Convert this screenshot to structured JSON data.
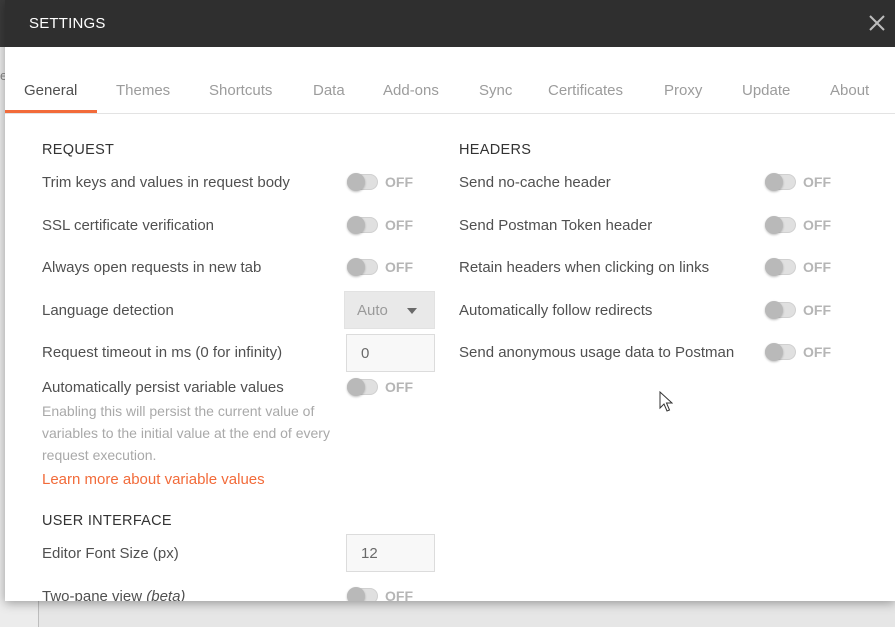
{
  "modal": {
    "title": "SETTINGS"
  },
  "tabs": [
    {
      "label": "General",
      "active": true
    },
    {
      "label": "Themes"
    },
    {
      "label": "Shortcuts"
    },
    {
      "label": "Data"
    },
    {
      "label": "Add-ons"
    },
    {
      "label": "Sync"
    },
    {
      "label": "Certificates"
    },
    {
      "label": "Proxy"
    },
    {
      "label": "Update"
    },
    {
      "label": "About"
    }
  ],
  "request": {
    "title": "REQUEST",
    "trim_keys": "Trim keys and values in request body",
    "ssl_verify": "SSL certificate verification",
    "open_new_tab": "Always open requests in new tab",
    "language_detection": "Language detection",
    "language_value": "Auto",
    "timeout": "Request timeout in ms (0 for infinity)",
    "timeout_value": "0",
    "persist_vars": "Automatically persist variable values",
    "persist_help": "Enabling this will persist the current value of variables to the initial value at the end of every request execution.",
    "persist_link": "Learn more about variable values"
  },
  "ui": {
    "title": "USER INTERFACE",
    "font_size": "Editor Font Size (px)",
    "font_size_value": "12",
    "two_pane": "Two-pane view",
    "two_pane_beta": "(beta)"
  },
  "headers": {
    "title": "HEADERS",
    "no_cache": "Send no-cache header",
    "postman_token": "Send Postman Token header",
    "retain_headers": "Retain headers when clicking on links",
    "follow_redirects": "Automatically follow redirects",
    "anon_usage": "Send anonymous usage data to Postman"
  },
  "toggle_state": "OFF",
  "colors": {
    "accent": "#f26b3a",
    "header_bg": "#2f2f2f"
  }
}
